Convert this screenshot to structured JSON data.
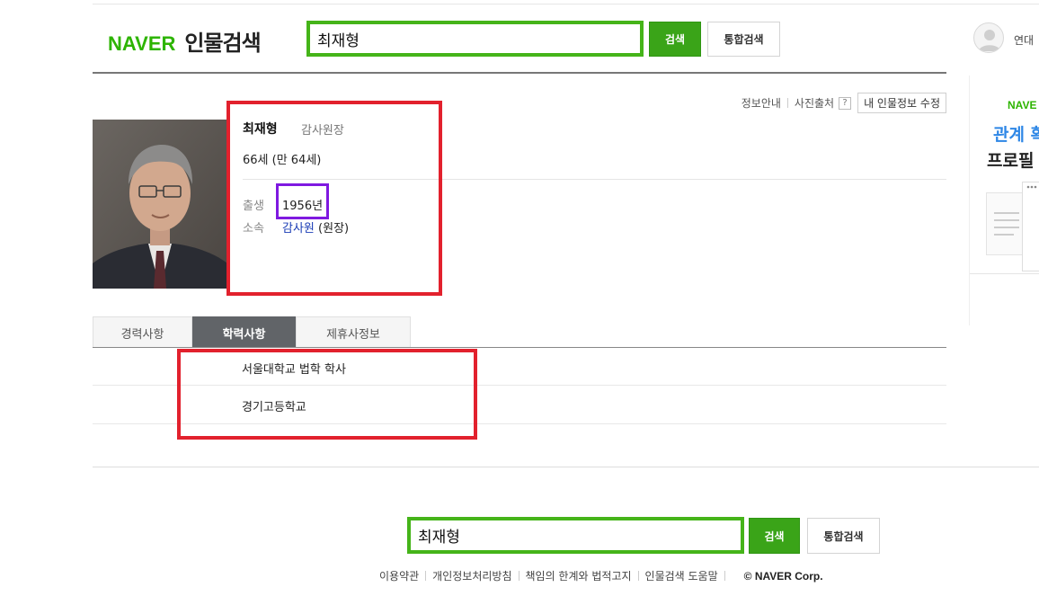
{
  "header": {
    "logo_brand": "NAVER",
    "logo_title": "인물검색",
    "search_value": "최재형",
    "search_button": "검색",
    "total_search_button": "통합검색",
    "user_label": "연대"
  },
  "info_links": {
    "info": "정보안내",
    "photo_source": "사진출처",
    "help": "?",
    "edit": "내 인물정보 수정"
  },
  "profile": {
    "name": "최재형",
    "title": "감사원장",
    "age": "66세 (만 64세)",
    "birth_label": "출생",
    "birth_value": "1956년",
    "affiliation_label": "소속",
    "affiliation_link": "감사원",
    "affiliation_role": "(원장)"
  },
  "tabs": [
    {
      "label": "경력사항"
    },
    {
      "label": "학력사항"
    },
    {
      "label": "제휴사정보"
    }
  ],
  "education": [
    "서울대학교 법학 학사",
    "경기고등학교"
  ],
  "bottom_search": {
    "value": "최재형",
    "search_button": "검색",
    "total_search_button": "통합검색"
  },
  "footer": {
    "links": [
      "이용약관",
      "개인정보처리방침",
      "책임의 한계와 법적고지",
      "인물검색 도움말"
    ],
    "copyright": "© NAVER Corp."
  },
  "sidebar": {
    "brand": "NAVE",
    "title": "관계 확",
    "subtitle": "프로필"
  },
  "colors": {
    "naver_green": "#2db400",
    "button_green": "#3aa418",
    "annotation_red": "#e2212d",
    "annotation_purple": "#7f19e0",
    "link_blue": "#1a3cb5",
    "active_tab": "#616468"
  }
}
